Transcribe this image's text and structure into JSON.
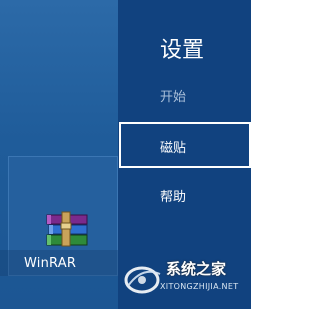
{
  "start_screen": {
    "tile": {
      "label": "WinRAR",
      "icon": "winrar-books-icon"
    }
  },
  "charm_panel": {
    "title": "设置",
    "items": [
      {
        "label": "开始",
        "state": "dim"
      },
      {
        "label": "磁贴",
        "state": "focused"
      },
      {
        "label": "帮助",
        "state": "normal"
      }
    ]
  },
  "watermark": {
    "logo_text": "系统之家",
    "url_text": "XITONGZHIJIA.NET"
  },
  "colors": {
    "start_bg": "#1f5c9a",
    "charm_bg": "#11427f",
    "text": "#ffffff",
    "dim_text": "#a9bfd9"
  }
}
